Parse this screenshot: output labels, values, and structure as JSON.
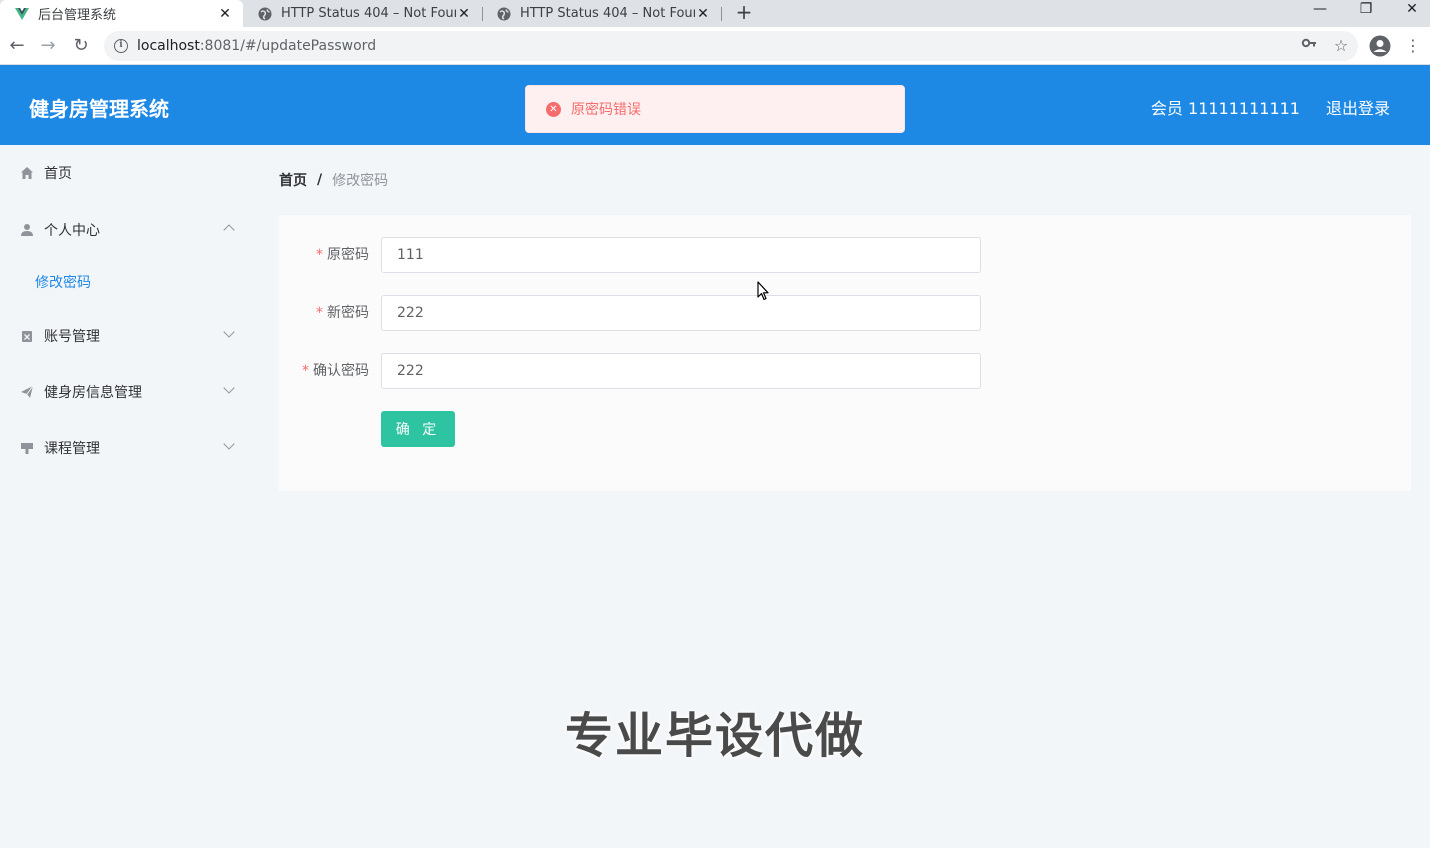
{
  "browser": {
    "tabs": [
      {
        "title": "后台管理系统",
        "active": true
      },
      {
        "title": "HTTP Status 404 – Not Found",
        "active": false
      },
      {
        "title": "HTTP Status 404 – Not Found",
        "active": false
      }
    ],
    "url_host": "localhost",
    "url_path": ":8081/#/updatePassword"
  },
  "header": {
    "title": "健身房管理系统",
    "user": "会员 11111111111",
    "logout": "退出登录"
  },
  "toast": {
    "message": "原密码错误",
    "color": "#f56c6c"
  },
  "sidebar": {
    "items": [
      {
        "label": "首页",
        "icon": "home-icon"
      },
      {
        "label": "个人中心",
        "icon": "user-icon",
        "expanded": true
      },
      {
        "label": "修改密码",
        "sub": true
      },
      {
        "label": "账号管理",
        "icon": "account-icon"
      },
      {
        "label": "健身房信息管理",
        "icon": "send-icon"
      },
      {
        "label": "课程管理",
        "icon": "course-icon"
      }
    ]
  },
  "breadcrumb": {
    "home": "首页",
    "separator": "/",
    "current": "修改密码"
  },
  "form": {
    "old_password": {
      "label": "原密码",
      "value": "111"
    },
    "new_password": {
      "label": "新密码",
      "value": "222"
    },
    "confirm_password": {
      "label": "确认密码",
      "value": "222"
    },
    "required_mark": "*",
    "submit_label": "确 定"
  },
  "watermark": "专业毕设代做",
  "colors": {
    "header_bg": "#1e88e5",
    "button_bg": "#2ec3a1",
    "accent": "#1e88e5"
  }
}
